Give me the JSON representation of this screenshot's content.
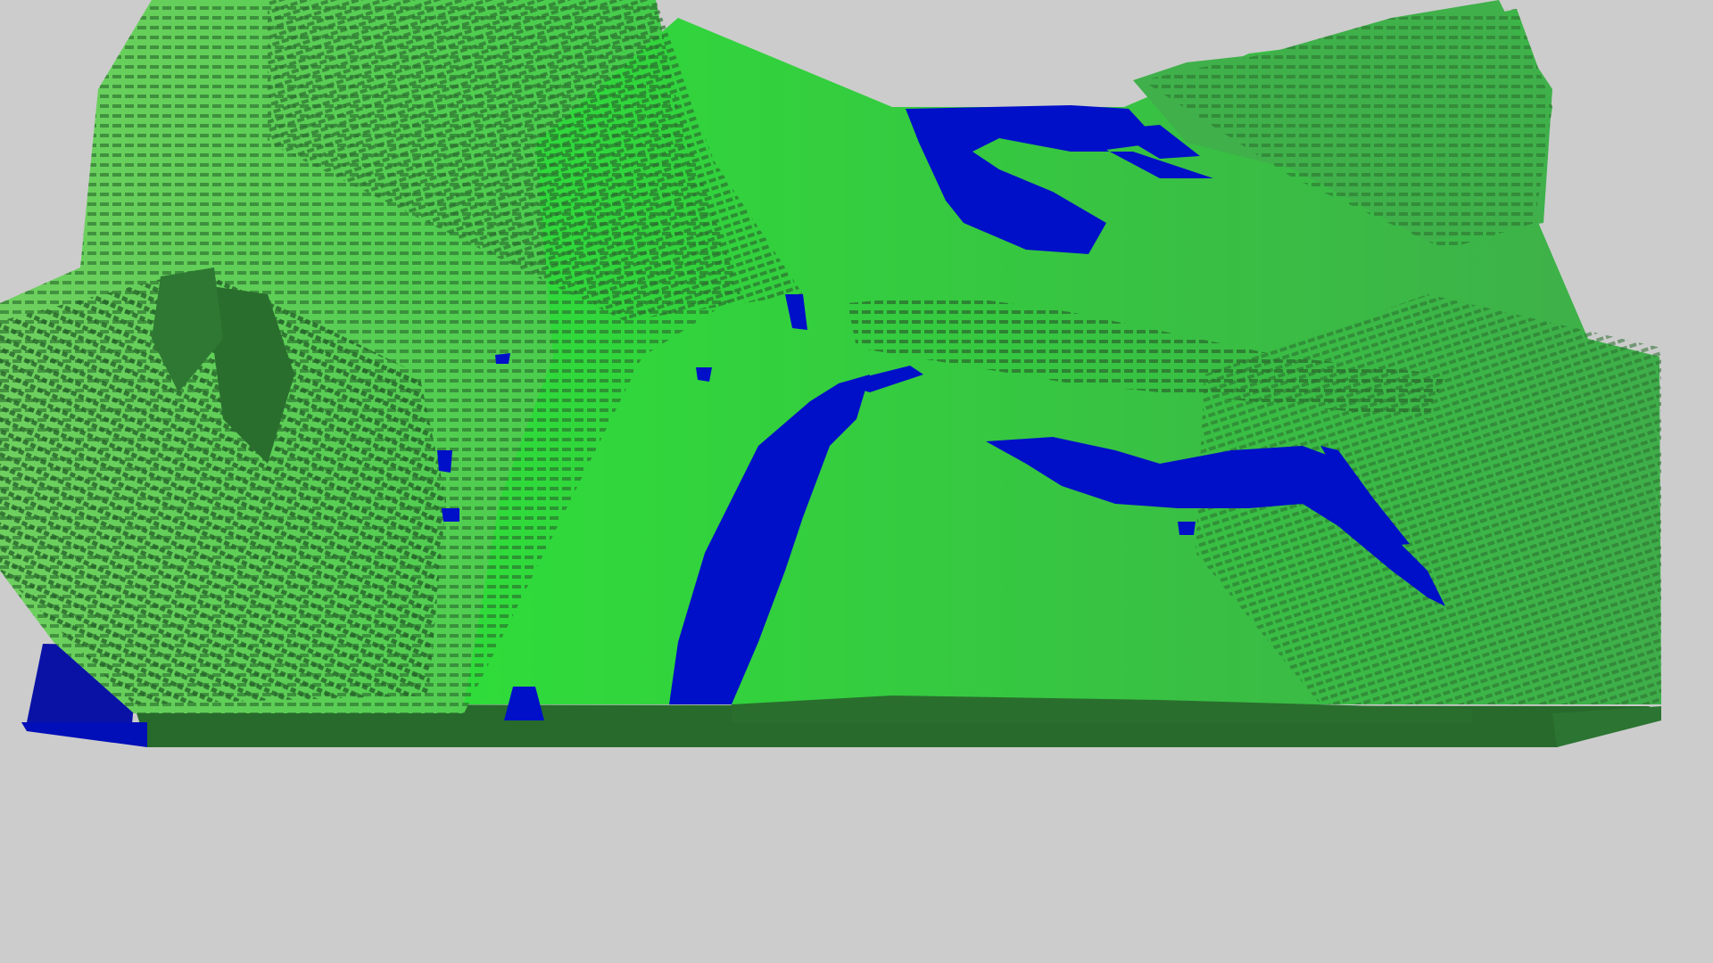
{
  "scene": {
    "kind": "voxel-terrain",
    "background_color": "#cccccc",
    "palette": {
      "grass_light": "#2fe03a",
      "grass_mid": "#34c43e",
      "grass_sunlit": "#5fc95a",
      "grass_dark": "#2a6e2e",
      "grass_shadow": "#235f28",
      "water": "#0010c8",
      "water_dark": "#0a0f9a",
      "base_side": "#276a2c"
    },
    "materials": [
      "grass",
      "water"
    ],
    "icons": {
      "terrain": "terrain-icon",
      "water": "water-icon"
    }
  }
}
